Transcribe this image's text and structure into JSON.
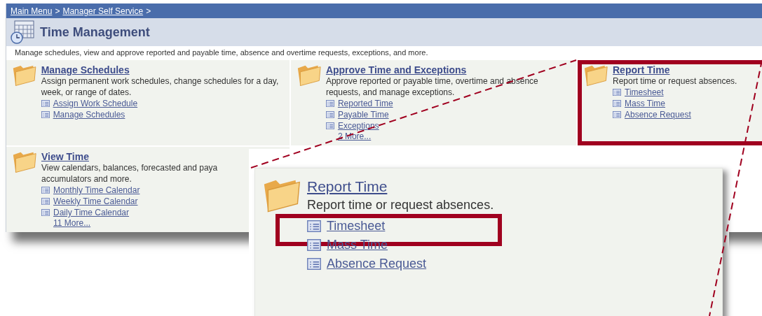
{
  "breadcrumb": {
    "links": [
      "Main Menu",
      "Manager Self Service"
    ],
    "separator": ">"
  },
  "title": "Time Management",
  "description": "Manage schedules, view and approve reported and payable time, absence and overtime requests, exceptions, and more.",
  "categories": [
    {
      "title": "Manage Schedules",
      "description": "Assign permanent work schedules, change schedules for a day, week, or range of dates.",
      "links": [
        "Assign Work Schedule",
        "Manage Schedules"
      ],
      "highlighted": false
    },
    {
      "title": "Approve Time and Exceptions",
      "description": "Approve reported or payable time, overtime and absence requests, and manage exceptions.",
      "links": [
        "Reported Time",
        "Payable Time",
        "Exceptions"
      ],
      "more": "2 More...",
      "highlighted": false
    },
    {
      "title": "Report Time",
      "description": "Report time or request absences.",
      "links": [
        "Timesheet",
        "Mass Time",
        "Absence Request"
      ],
      "highlighted": true
    },
    {
      "title": "View Time",
      "description": "View calendars, balances, forecasted and paya",
      "description_2": "accumulators and more.",
      "links": [
        "Monthly Time Calendar",
        "Weekly Time Calendar",
        "Daily Time Calendar"
      ],
      "more": "11 More...",
      "highlighted": false
    }
  ],
  "callout": {
    "title": "Report Time",
    "description": "Report time or request absences.",
    "links": [
      {
        "label": "Timesheet",
        "highlighted": true
      },
      {
        "label": "Mass Time",
        "highlighted": false
      },
      {
        "label": "Absence Request",
        "highlighted": false
      }
    ]
  }
}
